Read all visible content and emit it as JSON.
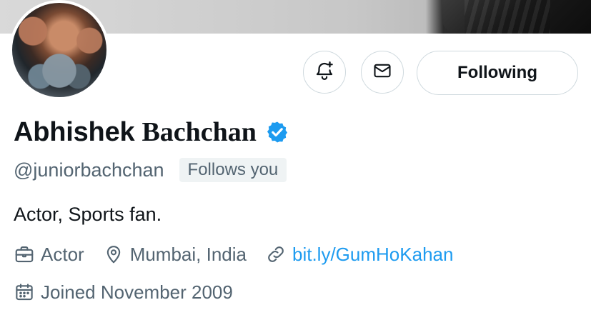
{
  "profile": {
    "display_name_first": "Abhishek",
    "display_name_last": "Bachchan",
    "verified_icon": "verified-badge-icon",
    "handle": "@juniorbachchan",
    "follows_you": "Follows you",
    "bio": "Actor, Sports fan.",
    "profession": "Actor",
    "location": "Mumbai, India",
    "website": "bit.ly/GumHoKahan",
    "joined": "Joined November 2009"
  },
  "actions": {
    "notifications_icon": "bell-plus-icon",
    "message_icon": "envelope-icon",
    "following_label": "Following"
  },
  "colors": {
    "text_primary": "#0f1419",
    "text_secondary": "#536471",
    "accent": "#1d9bf0",
    "border": "#cfd9de",
    "badge_bg": "#eff3f4"
  }
}
